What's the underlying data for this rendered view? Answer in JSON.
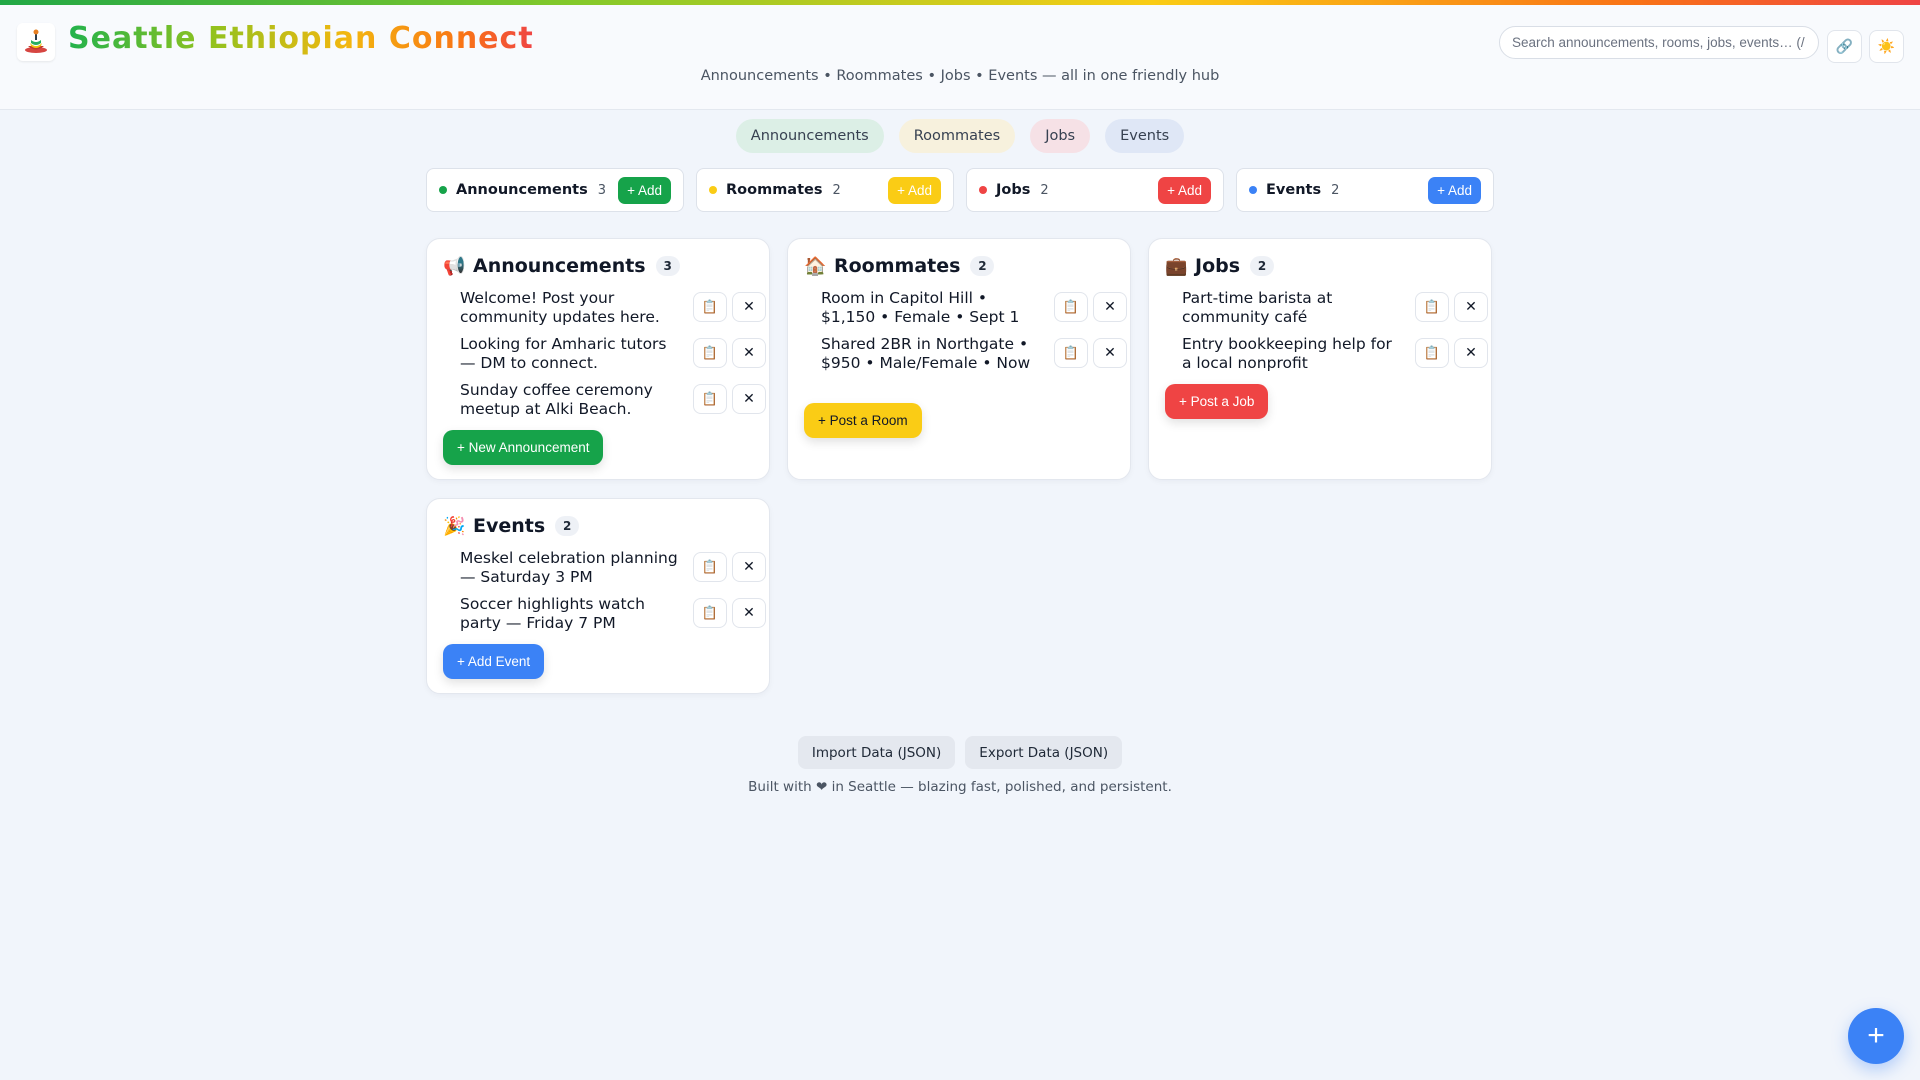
{
  "header": {
    "brand": "Seattle Ethiopian Connect",
    "tagline": "Announcements • Roommates • Jobs • Events — all in one friendly hub",
    "search_placeholder": "Search announcements, rooms, jobs, events… (/ t",
    "link_icon": "🔗",
    "theme_icon": "☀️"
  },
  "colors": {
    "announcements": "#16a34a",
    "roommates": "#facc15",
    "jobs": "#ef4444",
    "events": "#3b82f6"
  },
  "filters": [
    "Announcements",
    "Roommates",
    "Jobs",
    "Events"
  ],
  "summary": [
    {
      "name": "Announcements",
      "count": "3",
      "add": "+ Add"
    },
    {
      "name": "Roommates",
      "count": "2",
      "add": "+ Add"
    },
    {
      "name": "Jobs",
      "count": "2",
      "add": "+ Add"
    },
    {
      "name": "Events",
      "count": "2",
      "add": "+ Add"
    }
  ],
  "cards": {
    "announcements": {
      "emoji": "📢",
      "title": "Announcements",
      "count": "3",
      "items": [
        "Welcome! Post your community updates here.",
        "Looking for Amharic tutors — DM to connect.",
        "Sunday coffee ceremony meetup at Alki Beach."
      ],
      "cta": "+ New Announcement"
    },
    "roommates": {
      "emoji": "🏠",
      "title": "Roommates",
      "count": "2",
      "items": [
        "Room in Capitol Hill • $1,150 • Female • Sept 1",
        "Shared 2BR in Northgate • $950 • Male/Female • Now"
      ],
      "cta": "+ Post a Room"
    },
    "jobs": {
      "emoji": "💼",
      "title": "Jobs",
      "count": "2",
      "items": [
        "Part-time barista at community café",
        "Entry bookkeeping help for a local nonprofit"
      ],
      "cta": "+ Post a Job"
    },
    "events": {
      "emoji": "🎉",
      "title": "Events",
      "count": "2",
      "items": [
        "Meskel celebration planning — Saturday 3 PM",
        "Soccer highlights watch party — Friday 7 PM"
      ],
      "cta": "+ Add Event"
    }
  },
  "item_actions": {
    "copy_icon": "📋",
    "delete_icon": "✕"
  },
  "footer": {
    "import": "Import Data (JSON)",
    "export": "Export Data (JSON)",
    "note": "Built with ❤ in Seattle — blazing fast, polished, and persistent."
  },
  "fab": "+"
}
